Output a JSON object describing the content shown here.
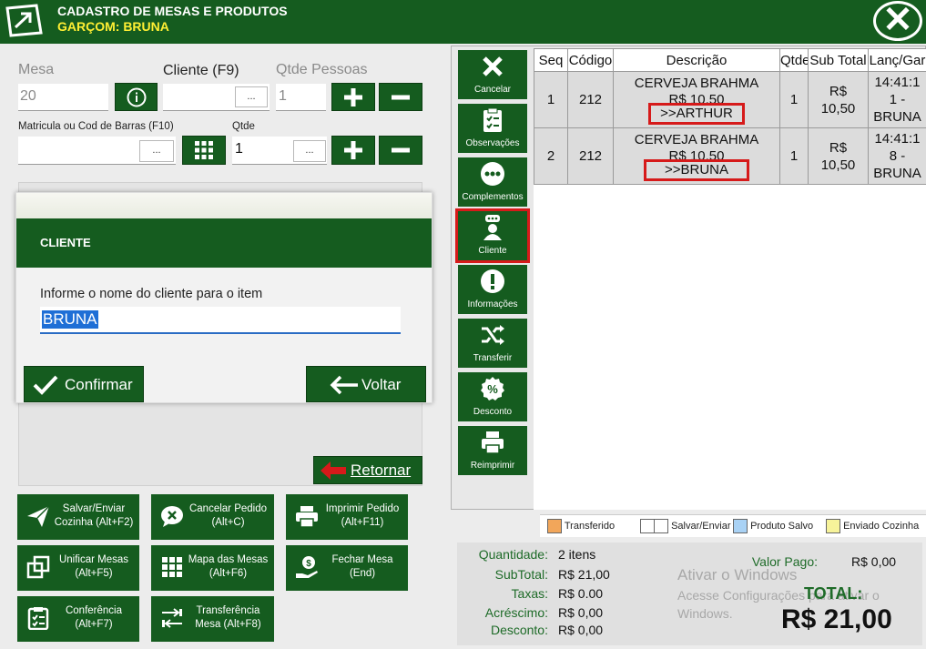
{
  "header": {
    "title": "CADASTRO DE MESAS E PRODUTOS",
    "waiter": "GARÇOM: BRUNA"
  },
  "form": {
    "mesa_label": "Mesa",
    "mesa_value": "20",
    "cliente_label": "Cliente (F9)",
    "cliente_value": "",
    "qtde_pessoas_label": "Qtde Pessoas",
    "qtde_pessoas_value": "1",
    "matricula_label": "Matricula ou Cod de Barras (F10)",
    "matricula_value": "",
    "qtde_label": "Qtde",
    "qtde_value": "1",
    "dots": "..."
  },
  "dialog": {
    "title": "CLIENTE",
    "prompt": "Informe o nome do cliente para o item",
    "value": "BRUNA",
    "confirm": "Confirmar",
    "back": "Voltar"
  },
  "retornar": "Retornar",
  "actions": [
    {
      "label": "Salvar/Enviar Cozinha (Alt+F2)"
    },
    {
      "label": "Cancelar Pedido (Alt+C)"
    },
    {
      "label": "Imprimir Pedido (Alt+F11)"
    },
    {
      "label": "Unificar Mesas (Alt+F5)"
    },
    {
      "label": "Mapa das Mesas (Alt+F6)"
    },
    {
      "label": "Fechar Mesa (End)"
    },
    {
      "label": "Conferência (Alt+F7)"
    },
    {
      "label": "Transferência Mesa (Alt+F8)"
    }
  ],
  "side": [
    "Cancelar",
    "Observações",
    "Complementos",
    "Cliente",
    "Informações",
    "Transferir",
    "Desconto",
    "Reimprimir"
  ],
  "table": {
    "headers": [
      "Seq",
      "Código",
      "Descrição",
      "Qtde",
      "Sub Total",
      "Lanç/Gar"
    ],
    "rows": [
      {
        "seq": "1",
        "codigo": "212",
        "desc": "CERVEJA BRAHMA",
        "price": "R$ 10,50",
        "client": ">>ARTHUR",
        "qtde": "1",
        "sub1": "R$",
        "sub2": "10,50",
        "lanc1": "14:41:1",
        "lanc2": "1 -",
        "lanc3": "BRUNA"
      },
      {
        "seq": "2",
        "codigo": "212",
        "desc": "CERVEJA BRAHMA",
        "price": "R$ 10,50",
        "client": ">>BRUNA",
        "qtde": "1",
        "sub1": "R$",
        "sub2": "10,50",
        "lanc1": "14:41:1",
        "lanc2": "8 -",
        "lanc3": "BRUNA"
      }
    ]
  },
  "legend": [
    {
      "label": "Transferido",
      "color": "#f2a65a"
    },
    {
      "label": "Salvar/Enviar",
      "color": "#ffffff"
    },
    {
      "label": "Produto Salvo",
      "color": "#a9d2f5"
    },
    {
      "label": "Enviado Cozinha",
      "color": "#f7f39a"
    }
  ],
  "summary": {
    "quantidade_label": "Quantidade:",
    "quantidade": "2 itens",
    "subtotal_label": "SubTotal:",
    "subtotal": "R$ 21,00",
    "taxas_label": "Taxas:",
    "taxas": "R$ 0.00",
    "acrescimo_label": "Acréscimo:",
    "acrescimo": "R$ 0,00",
    "desconto_label": "Desconto:",
    "desconto": "R$ 0,00",
    "valor_pago_label": "Valor Pago:",
    "valor_pago": "R$ 0,00",
    "total_label": "TOTAL:",
    "total": "R$ 21,00"
  },
  "watermark": {
    "line1": "Ativar o Windows",
    "line2": "Acesse Configurações para ativar o",
    "line3": "Windows."
  },
  "colors": {
    "primary": "#155c1f",
    "highlight": "#d61a1a"
  }
}
